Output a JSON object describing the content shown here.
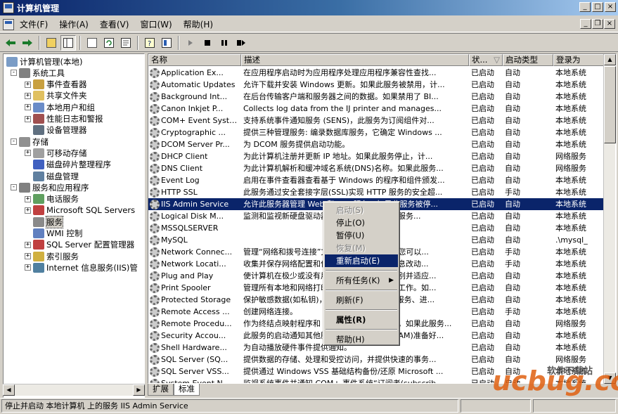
{
  "window": {
    "title": "计算机管理",
    "minimize": "_",
    "maximize": "□",
    "close": "×"
  },
  "menu": [
    {
      "label": "文件(F)"
    },
    {
      "label": "操作(A)"
    },
    {
      "label": "查看(V)"
    },
    {
      "label": "窗口(W)"
    },
    {
      "label": "帮助(H)"
    }
  ],
  "toolbar": {
    "icons": [
      "back-arrow-icon",
      "forward-arrow-icon",
      "up-folder-icon",
      "show-tree-icon",
      "properties-icon",
      "refresh-icon",
      "export-icon",
      "help-icon",
      "help-topics-icon",
      "start-service-icon",
      "stop-service-icon",
      "pause-service-icon",
      "restart-service-icon"
    ]
  },
  "tree": [
    {
      "label": "计算机管理(本地)",
      "level": 0,
      "expand": "",
      "icon": "computer-icon"
    },
    {
      "label": "系统工具",
      "level": 1,
      "expand": "-",
      "icon": "tools-icon"
    },
    {
      "label": "事件查看器",
      "level": 2,
      "expand": "+",
      "icon": "event-viewer-icon"
    },
    {
      "label": "共享文件夹",
      "level": 2,
      "expand": "+",
      "icon": "shared-folder-icon"
    },
    {
      "label": "本地用户和组",
      "level": 2,
      "expand": "+",
      "icon": "users-icon"
    },
    {
      "label": "性能日志和警报",
      "level": 2,
      "expand": "+",
      "icon": "performance-icon"
    },
    {
      "label": "设备管理器",
      "level": 2,
      "expand": "",
      "icon": "device-manager-icon"
    },
    {
      "label": "存储",
      "level": 1,
      "expand": "-",
      "icon": "storage-icon"
    },
    {
      "label": "可移动存储",
      "level": 2,
      "expand": "+",
      "icon": "removable-storage-icon"
    },
    {
      "label": "磁盘碎片整理程序",
      "level": 2,
      "expand": "",
      "icon": "defrag-icon"
    },
    {
      "label": "磁盘管理",
      "level": 2,
      "expand": "",
      "icon": "disk-icon"
    },
    {
      "label": "服务和应用程序",
      "level": 1,
      "expand": "-",
      "icon": "services-apps-icon"
    },
    {
      "label": "电话服务",
      "level": 2,
      "expand": "+",
      "icon": "telephony-icon"
    },
    {
      "label": "Microsoft SQL Servers",
      "level": 2,
      "expand": "+",
      "icon": "sql-server-icon"
    },
    {
      "label": "服务",
      "level": 2,
      "expand": "",
      "icon": "services-gear-icon",
      "selected": true
    },
    {
      "label": "WMI 控制",
      "level": 2,
      "expand": "",
      "icon": "wmi-icon"
    },
    {
      "label": "SQL Server 配置管理器",
      "level": 2,
      "expand": "+",
      "icon": "sql-config-icon"
    },
    {
      "label": "索引服务",
      "level": 2,
      "expand": "+",
      "icon": "index-icon"
    },
    {
      "label": "Internet 信息服务(IIS)管",
      "level": 2,
      "expand": "+",
      "icon": "iis-icon"
    }
  ],
  "columns": [
    {
      "label": "名称"
    },
    {
      "label": "描述"
    },
    {
      "label": "状..."
    },
    {
      "label": "启动类型"
    },
    {
      "label": "登录为"
    }
  ],
  "services": [
    {
      "name": "Application Ex...",
      "desc": "在应用程序启动时为应用程序处理应用程序兼容性查找...",
      "status": "已启动",
      "startup": "自动",
      "logon": "本地系统"
    },
    {
      "name": "Automatic Updates",
      "desc": "允许下载并安装 Windows 更新。如果此服务被禁用，计...",
      "status": "已启动",
      "startup": "自动",
      "logon": "本地系统"
    },
    {
      "name": "Background Int...",
      "desc": "在后台传输客户端和服务器之间的数据。如果禁用了 BI...",
      "status": "已启动",
      "startup": "自动",
      "logon": "本地系统"
    },
    {
      "name": "Canon Inkjet P...",
      "desc": "Collects log data from the IJ printer and manages...",
      "status": "已启动",
      "startup": "自动",
      "logon": "本地系统"
    },
    {
      "name": "COM+ Event System",
      "desc": "支持系统事件通知服务 (SENS)，此服务为订阅组件对...",
      "status": "已启动",
      "startup": "自动",
      "logon": "本地系统"
    },
    {
      "name": "Cryptographic ...",
      "desc": "提供三种管理服务: 编录数据库服务，它确定 Windows ...",
      "status": "已启动",
      "startup": "自动",
      "logon": "本地系统"
    },
    {
      "name": "DCOM Server Pr...",
      "desc": "为 DCOM 服务提供启动功能。",
      "status": "已启动",
      "startup": "自动",
      "logon": "本地系统"
    },
    {
      "name": "DHCP Client",
      "desc": "为此计算机注册并更新 IP 地址。如果此服务停止，计...",
      "status": "已启动",
      "startup": "自动",
      "logon": "网络服务"
    },
    {
      "name": "DNS Client",
      "desc": "为此计算机解析和缓冲域名系统(DNS)名称。如果此服务...",
      "status": "已启动",
      "startup": "自动",
      "logon": "网络服务"
    },
    {
      "name": "Event Log",
      "desc": "启用在事件查看器查看基于 Windows 的程序和组件颁发...",
      "status": "已启动",
      "startup": "自动",
      "logon": "本地系统"
    },
    {
      "name": "HTTP SSL",
      "desc": "此服务通过安全套接字层(SSL)实现 HTTP 服务的安全超...",
      "status": "已启动",
      "startup": "手动",
      "logon": "本地系统"
    },
    {
      "name": "IIS Admin Service",
      "desc": "允许此服务器管理 Web 和 FTP 服务。如果此服务被停...",
      "status": "已启动",
      "startup": "自动",
      "logon": "本地系统",
      "selected": true
    },
    {
      "name": "Logical Disk M...",
      "desc": "监测和监视新硬盘驱动器并向逻辑磁盘管理器服务...",
      "status": "已启动",
      "startup": "自动",
      "logon": "本地系统"
    },
    {
      "name": "MSSQLSERVER",
      "desc": "",
      "status": "已启动",
      "startup": "自动",
      "logon": "本地系统"
    },
    {
      "name": "MySQL",
      "desc": "",
      "status": "已启动",
      "startup": "自动",
      "logon": ".\\mysql_"
    },
    {
      "name": "Network Connec...",
      "desc": "管理“网络和拨号连接”文件夹中对象，在其中您可以...",
      "status": "已启动",
      "startup": "手动",
      "logon": "本地系统"
    },
    {
      "name": "Network Locati...",
      "desc": "收集并保存网络配置和位置信息，并在这些信息改动...",
      "status": "已启动",
      "startup": "手动",
      "logon": "本地系统"
    },
    {
      "name": "Plug and Play",
      "desc": "使计算机在极少或没有用户输入的情况下能识别并适应...",
      "status": "已启动",
      "startup": "自动",
      "logon": "本地系统"
    },
    {
      "name": "Print Spooler",
      "desc": "管理所有本地和网络打印队列及控制所有打印工作。如...",
      "status": "已启动",
      "startup": "自动",
      "logon": "本地系统"
    },
    {
      "name": "Protected Storage",
      "desc": "保护敏感数据(如私钥)，以便防止未经授权的服务、进...",
      "status": "已启动",
      "startup": "自动",
      "logon": "本地系统"
    },
    {
      "name": "Remote Access ...",
      "desc": "创建网络连接。",
      "status": "已启动",
      "startup": "手动",
      "logon": "本地系统"
    },
    {
      "name": "Remote Procedu...",
      "desc": "作为终结点映射程序和 COM 服务控制管理器。如果此服务...",
      "status": "已启动",
      "startup": "自动",
      "logon": "网络服务"
    },
    {
      "name": "Security Accou...",
      "desc": "此服务的启动通知其他服务安全帐户管理器(SAM)准备好...",
      "status": "已启动",
      "startup": "自动",
      "logon": "本地系统"
    },
    {
      "name": "Shell Hardware...",
      "desc": "为自动播放硬件事件提供通知。",
      "status": "已启动",
      "startup": "自动",
      "logon": "本地系统"
    },
    {
      "name": "SQL Server (SQ...",
      "desc": "提供数据的存储、处理和受控访问，并提供快速的事务...",
      "status": "已启动",
      "startup": "自动",
      "logon": "网络服务"
    },
    {
      "name": "SQL Server VSS...",
      "desc": "提供通过 Windows VSS 基础结构备份/还原 Microsoft ...",
      "status": "已启动",
      "startup": "自动",
      "logon": "本地系统"
    },
    {
      "name": "System Event N...",
      "desc": "监视系统事件并通知 COM+ 事件系统“订阅者(subscrib...",
      "status": "已启动",
      "startup": "自动",
      "logon": "本地系统"
    }
  ],
  "context_menu": [
    {
      "label": "启动(S)",
      "disabled": true
    },
    {
      "label": "停止(O)"
    },
    {
      "label": "暂停(U)"
    },
    {
      "label": "恢复(M)",
      "disabled": true
    },
    {
      "label": "重新启动(E)",
      "highlighted": true
    },
    {
      "sep": true
    },
    {
      "label": "所有任务(K)",
      "submenu": true
    },
    {
      "sep": true
    },
    {
      "label": "刷新(F)"
    },
    {
      "sep": true
    },
    {
      "label": "属性(R)",
      "bold": true
    },
    {
      "sep": true
    },
    {
      "label": "帮助(H)"
    }
  ],
  "tabs": [
    {
      "label": "扩展"
    },
    {
      "label": "标准",
      "active": true
    }
  ],
  "status": {
    "text": "停止并启动 本地计算机 上的服务 IIS Admin Service"
  },
  "watermark": {
    "text": "ucbug.cc",
    "sub": "软件下载站"
  },
  "colors": {
    "title_start": "#0a246a",
    "title_end": "#a6caf0",
    "selection": "#0a246a",
    "face": "#d4d0c8"
  }
}
